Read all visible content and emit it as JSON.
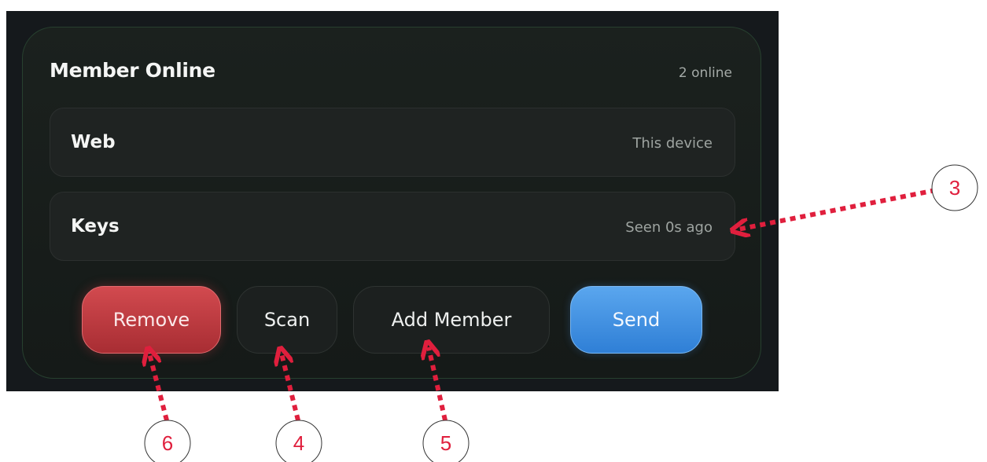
{
  "panel": {
    "title": "Member Online",
    "online_count": "2 online"
  },
  "devices": [
    {
      "name": "Web",
      "status": "This device"
    },
    {
      "name": "Keys",
      "status": "Seen 0s ago"
    }
  ],
  "actions": {
    "remove_label": "Remove",
    "scan_label": "Scan",
    "add_member_label": "Add Member",
    "send_label": "Send"
  },
  "annotations": {
    "callout_3": "3",
    "callout_4": "4",
    "callout_5": "5",
    "callout_6": "6",
    "color": "#e01f3d"
  },
  "colors": {
    "background": "#15191c",
    "panel_border": "#27402f",
    "remove_button": "#c0393f",
    "send_button": "#3d8fe0"
  }
}
